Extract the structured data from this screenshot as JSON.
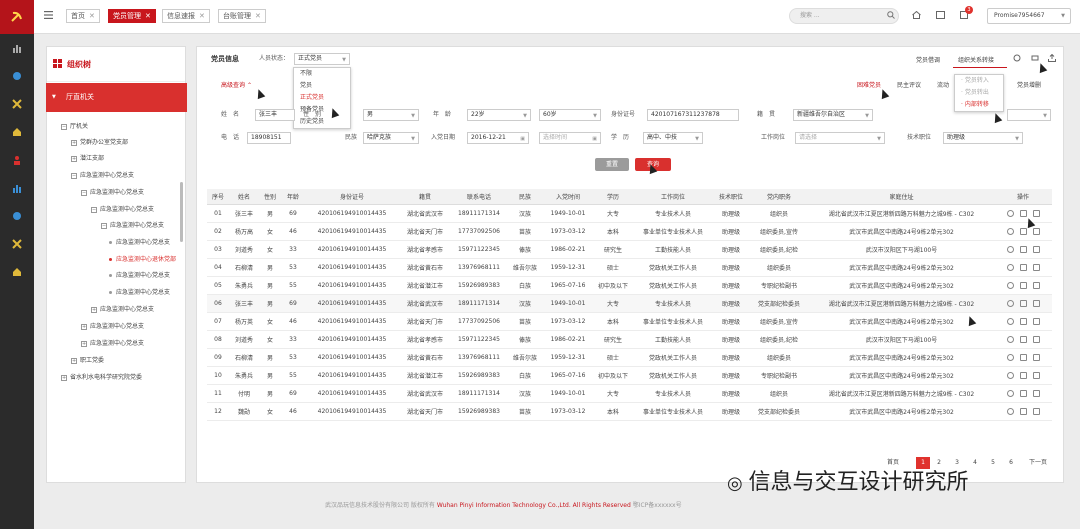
{
  "nav": {
    "tabs": [
      {
        "label": "首页"
      },
      {
        "label": "党员管理"
      },
      {
        "label": "信息速报"
      },
      {
        "label": "台账管理"
      }
    ],
    "search_placeholder": "搜索 ...",
    "badge": "3",
    "user": "Promise7954667"
  },
  "sidebar": {
    "title": "组织树",
    "selected": "厅直机关",
    "tree": [
      {
        "label": "厅机关",
        "type": "box",
        "mark": "−"
      },
      {
        "label": "党群办公室党支部",
        "type": "box",
        "mark": "+"
      },
      {
        "label": "潜江支部",
        "type": "box",
        "mark": "+"
      },
      {
        "label": "应急监测中心党总支",
        "type": "box",
        "mark": "−"
      },
      {
        "label": "应急监测中心党总支",
        "type": "box",
        "mark": "−"
      },
      {
        "label": "应急监测中心党总支",
        "type": "box",
        "mark": "−"
      },
      {
        "label": "应急监测中心党总支",
        "type": "box",
        "mark": "−"
      },
      {
        "label": "应急监测中心党总支",
        "type": "dot"
      },
      {
        "label": "应急监测中心退休党部",
        "type": "dot",
        "red": true
      },
      {
        "label": "应急监测中心党总支",
        "type": "dot"
      },
      {
        "label": "应急监测中心党总支",
        "type": "dot"
      },
      {
        "label": "应急监测中心党总支",
        "type": "box",
        "mark": "+"
      },
      {
        "label": "应急监测中心党总支",
        "type": "box",
        "mark": "+"
      },
      {
        "label": "应急监测中心党总支",
        "type": "box",
        "mark": "+"
      },
      {
        "label": "职工党委",
        "type": "box",
        "mark": "+"
      },
      {
        "label": "省水利水电科学研究院党委",
        "type": "box",
        "mark": "+"
      }
    ]
  },
  "panel": {
    "title": "党员信息",
    "status_label": "人员状态：",
    "status_value": "正式党员",
    "status_options": [
      "不限",
      "党员",
      "正式党员",
      "预备党员",
      "历史党员"
    ],
    "advanced": "高级查询",
    "top_actions": [
      "党员借调",
      "组织关系转接"
    ],
    "subtabs": [
      "困难党员",
      "民主评议",
      "流动",
      "党费缴纳",
      "党员增删"
    ],
    "transfer_menu": [
      "党员转入",
      "党员转出",
      "内部转移"
    ]
  },
  "form": {
    "name_label": "姓　名",
    "name_value": "张三丰",
    "gender_label": "性　别",
    "gender_value": "男",
    "age_label": "年　龄",
    "age_from": "22岁",
    "age_to": "60岁",
    "id_label": "身份证号",
    "id_value": "420107167311237878",
    "native_label": "籍　贯",
    "native_value": "新疆维吾尔自治区",
    "phone_label": "电　话",
    "phone_value": "18908151",
    "ethnic_label": "民族",
    "ethnic_value": "哈萨克族",
    "join_label": "入党日期",
    "join_from": "2016-12-21",
    "join_to_ph": "选择时间",
    "edu_label": "学　历",
    "edu_value": "高中、中技",
    "job_label": "工作岗位",
    "job_ph": "请选择",
    "title_label": "技术职位",
    "title_value": "助理级",
    "reset": "重置",
    "query": "查询"
  },
  "table": {
    "headers": [
      "序号",
      "姓名",
      "性别",
      "年龄",
      "身份证号",
      "籍贯",
      "联系电话",
      "民族",
      "入党时间",
      "学历",
      "工作岗位",
      "技术职位",
      "党内职务",
      "家庭住址",
      "操作"
    ],
    "rows": [
      [
        "01",
        "张三丰",
        "男",
        "69",
        "420106194910014435",
        "湖北省武汉市",
        "18911171314",
        "汉族",
        "1949-10-01",
        "大专",
        "专业技术人员",
        "助理级",
        "组织员",
        "湖北省武汉市江夏区港新四路万科魅力之城9栋 - C302"
      ],
      [
        "02",
        "杨万高",
        "女",
        "46",
        "420106194910014435",
        "湖北省天门市",
        "17737092506",
        "苗族",
        "1973-03-12",
        "本科",
        "事业单位专业技术人员",
        "助理级",
        "组织委员,宣传",
        "武汉市武昌区中南路24号9栋2单元302"
      ],
      [
        "03",
        "刘道秀",
        "女",
        "33",
        "420106194910014435",
        "湖北省孝感市",
        "15971122345",
        "傣族",
        "1986-02-21",
        "研究生",
        "工勤技能人员",
        "助理级",
        "组织委员,纪检",
        "武汉市汉阳区下马湖100号"
      ],
      [
        "04",
        "石柳清",
        "男",
        "53",
        "420106194910014435",
        "湖北省黄石市",
        "13976968111",
        "维吾尔族",
        "1959-12-31",
        "硕士",
        "党政机关工作人员",
        "助理级",
        "组织委员",
        "武汉市武昌区中南路24号9栋2单元302"
      ],
      [
        "05",
        "朱勇兵",
        "男",
        "55",
        "420106194910014435",
        "湖北省潜江市",
        "15926989383",
        "白族",
        "1965-07-16",
        "初中及以下",
        "党政机关工作人员",
        "助理级",
        "专职纪检副书",
        "武汉市武昌区中南路24号9栋2单元302"
      ],
      [
        "06",
        "张三丰",
        "男",
        "69",
        "420106194910014435",
        "湖北省武汉市",
        "18911171314",
        "汉族",
        "1949-10-01",
        "大专",
        "专业技术人员",
        "助理级",
        "党支部纪检委员",
        "湖北省武汉市江夏区港新四路万科魅力之城9栋 - C302"
      ],
      [
        "07",
        "杨万英",
        "女",
        "46",
        "420106194910014435",
        "湖北省天门市",
        "17737092506",
        "苗族",
        "1973-03-12",
        "本科",
        "事业单位专业技术人员",
        "助理级",
        "组织委员,宣传",
        "武汉市武昌区中南路24号9栋2单元302"
      ],
      [
        "08",
        "刘道秀",
        "女",
        "33",
        "420106194910014435",
        "湖北省孝感市",
        "15971122345",
        "傣族",
        "1986-02-21",
        "研究生",
        "工勤技能人员",
        "助理级",
        "组织委员,纪检",
        "武汉市汉阳区下马湖100号"
      ],
      [
        "09",
        "石柳清",
        "男",
        "53",
        "420106194910014435",
        "湖北省黄石市",
        "13976968111",
        "维吾尔族",
        "1959-12-31",
        "硕士",
        "党政机关工作人员",
        "助理级",
        "组织委员",
        "武汉市武昌区中南路24号9栋2单元302"
      ],
      [
        "10",
        "朱勇兵",
        "男",
        "55",
        "420106194910014435",
        "湖北省潜江市",
        "15926989383",
        "白族",
        "1965-07-16",
        "初中及以下",
        "党政机关工作人员",
        "助理级",
        "专职纪检副书",
        "武汉市武昌区中南路24号9栋2单元302"
      ],
      [
        "11",
        "付明",
        "男",
        "69",
        "420106194910014435",
        "湖北省武汉市",
        "18911171314",
        "汉族",
        "1949-10-01",
        "大专",
        "专业技术人员",
        "助理级",
        "组织员",
        "湖北省武汉市江夏区港新四路万科魅力之城9栋 - C302"
      ],
      [
        "12",
        "魏勋",
        "女",
        "46",
        "420106194910014435",
        "湖北省天门市",
        "15926989383",
        "苗族",
        "1973-03-12",
        "本科",
        "事业单位专业技术人员",
        "助理级",
        "党支部纪检委员",
        "武汉市武昌区中南路24号9栋2单元302"
      ]
    ],
    "highlight_row": 5
  },
  "pagination": {
    "prev": "首页",
    "pages": [
      "1",
      "2",
      "3",
      "4",
      "5",
      "6"
    ],
    "current": "1",
    "next": "下一页"
  },
  "footer": {
    "left": "武汉品玩信息技术股份有限公司 版权所有",
    "mid": "Wuhan Pinyi Information Technology Co.,Ltd. All Rights Reserved",
    "right": "鄂ICP备xxxxxx号"
  },
  "watermark": "信息与交互设计研究所",
  "colors": {
    "accent": "#c8161d",
    "sidebar_dark": "#2b2b2b"
  }
}
